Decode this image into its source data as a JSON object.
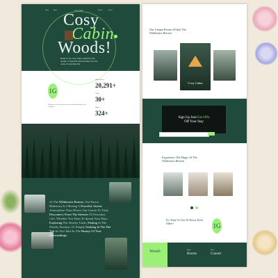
{
  "brand": "Cosy Cabin",
  "colors": {
    "dark_green": "#1f4a3c",
    "accent_green": "#9cf07a",
    "paper": "#f1e9dc"
  },
  "left": {
    "nav": [
      "Home",
      "About",
      "Rooms",
      "Contact"
    ],
    "hero_title": [
      "Cosy",
      "Cabin",
      "Woods!"
    ],
    "hero_sub": "Relax in our cosy cabin nestled in the woods. A peaceful retreat away from the noise of everyday life.",
    "badge": "1G",
    "stats": [
      {
        "label": "Happy Guests",
        "value": "20,291+"
      },
      {
        "label": "Cabins",
        "value": "30+"
      },
      {
        "label": "Nights",
        "value": "324+"
      }
    ],
    "intro_text": "Welcome to our cosy cabin retreat, surrounded by nature and tranquility.",
    "quote": {
      "pre": "At The",
      "b1": "Wilderness Retreat",
      "mid1": ", Our Forest Hideaway Is Offering A",
      "b2": "Peaceful, Serene",
      "mid2": "Atmosphere That Allows Our Guests To Truly",
      "b3": "Disconnect From The Stresses",
      "mid3": "Of Everyday Life. Whether You Want To Spend Your Days",
      "b4": "Exploring",
      "mid4": "The Nearby Trails,",
      "b5": "Fishing",
      "mid5": "In The Nearby Streams, Or Simply",
      "b6": "Soaking In The Hot Tub",
      "mid6": "As You Take In The",
      "b7": "Beauty Of Your Surroundings",
      "end": "."
    }
  },
  "right": {
    "section1_title": "Our Unique Rooms Within The Wilderness Retreat",
    "featured_card": "Cozy Cabin",
    "signup": {
      "line1": "Sign Up And",
      "highlight": "Get 10%",
      "line2": "Off Your Stay"
    },
    "section2_title": "Experience The Magic Of The Wilderness Retreat",
    "cta": "It's Time To Get To Know Each Other!",
    "cta_badge": "1G",
    "footer": {
      "brand": "Woods",
      "col1_label": "Menu",
      "col1": "Rooms",
      "col2_label": "Links",
      "col2": "Contact"
    }
  }
}
